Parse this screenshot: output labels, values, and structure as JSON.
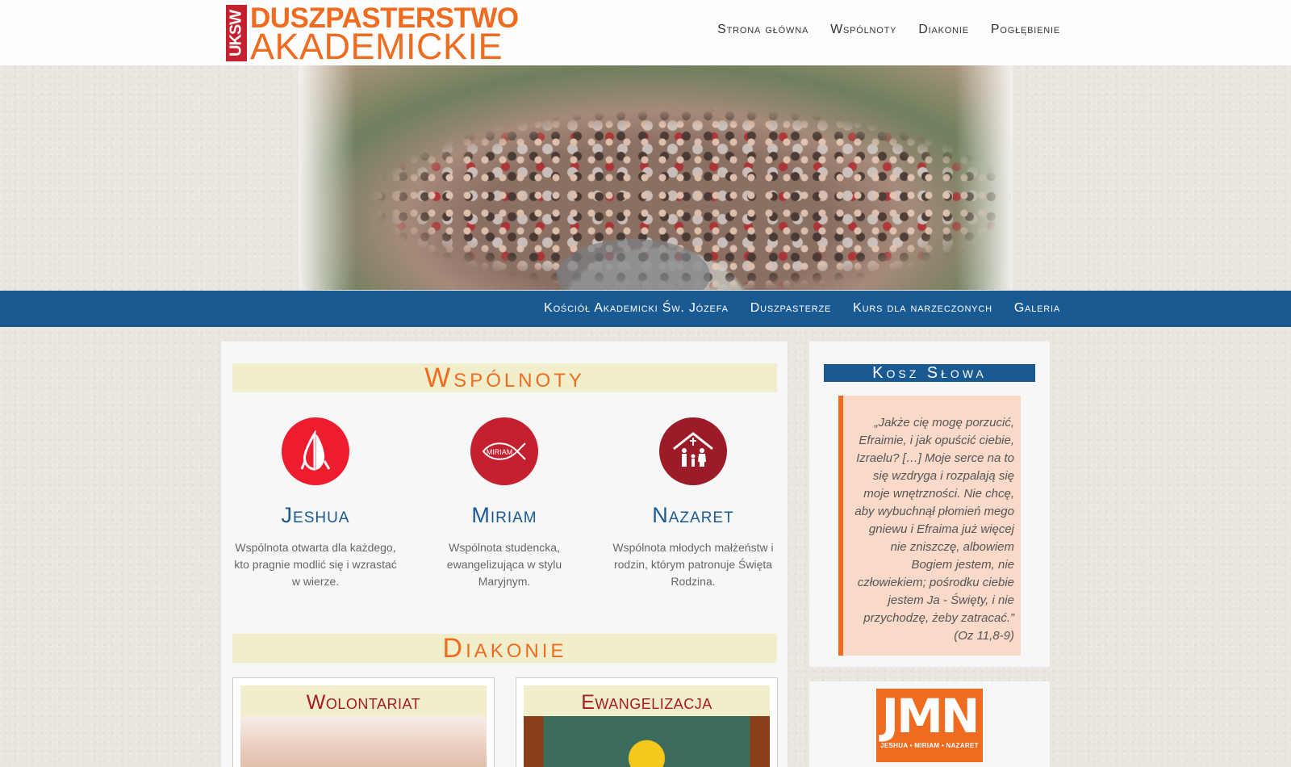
{
  "header": {
    "logo_badge": "UKSW",
    "logo_line1": "DUSZPASTERSTWO",
    "logo_line2": "AKADEMICKIE",
    "nav": [
      "Strona główna",
      "Wspólnoty",
      "Diakonie",
      "Pogłębienie"
    ]
  },
  "subnav": [
    "Kościół Akademicki Św. Józefa",
    "Duszpasterze",
    "Kurs dla narzeczonych",
    "Galeria"
  ],
  "main": {
    "section1_title": "Wspólnoty",
    "communities": [
      {
        "name": "Jeshua",
        "desc": "Wspólnota otwarta dla każdego, kto pragnie modlić się i wzrastać w wierze.",
        "color": "#ed1c2e",
        "icon": "praying-hands-icon"
      },
      {
        "name": "Miriam",
        "desc": "Wspólnota studencka, ewangelizująca w stylu Maryjnym.",
        "color": "#c4202f",
        "icon": "fish-icon",
        "icon_text": "MIRIAM"
      },
      {
        "name": "Nazaret",
        "desc": "Wspólnota młodych małżeństw i rodzin, którym patronuje Święta Rodzina.",
        "color": "#9b1b28",
        "icon": "family-house-icon"
      }
    ],
    "section2_title": "Diakonie",
    "diakonie": [
      {
        "title": "Wolontariat"
      },
      {
        "title": "Ewangelizacja"
      }
    ]
  },
  "sidebar": {
    "title": "Kosz Słowa",
    "quote": "„Jakże cię mogę porzucić, Efraimie, i jak opuścić ciebie, Izraelu? […] Moje serce na to się wzdryga i rozpalają się moje wnętrzności. Nie chcę, aby wybuchnął płomień mego gniewu i Efraima już więcej nie zniszczę, albowiem Bogiem jestem, nie człowiekiem; pośrodku ciebie jestem Ja - Święty, i nie przychodzę, żeby zatracać.” (Oz 11,8-9)",
    "jmn_big": "JMN",
    "jmn_small": "JESHUA • MIRIAM • NAZARET"
  },
  "colors": {
    "accent_orange": "#ee6b1f",
    "nav_blue": "#1a5a93",
    "title_bg": "#f1eecb"
  }
}
